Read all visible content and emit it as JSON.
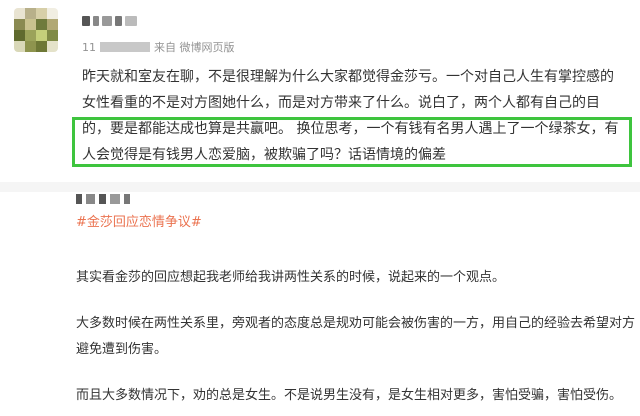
{
  "post": {
    "meta": {
      "date_prefix": "11",
      "source": "来自 微博网页版"
    },
    "lines": [
      "昨天就和室友在聊，不是很理解为什么大家都觉得金莎亏。一个对自己人生有掌控感的",
      "女性看重的不是对方图她什么，而是对方带来了什么。说白了，两个人都有自己的目",
      "的，要是都能达成也算是共赢吧。 换位思考，一个有钱有名男人遇上了一个绿茶女，有",
      "人会觉得是有钱男人恋爱脑，被欺骗了吗？话语情境的偏差"
    ],
    "highlight_color": "#3ec43e"
  },
  "article": {
    "hashtag": "#金莎回应恋情争议#",
    "hashtag_color": "#eb7350",
    "paragraphs": [
      "其实看金莎的回应想起我老师给我讲两性关系的时候，说起来的一个观点。",
      "大多数时候在两性关系里，旁观者的态度总是规劝可能会被伤害的一方，用自己的经验去希望对方",
      "避免遭到伤害。",
      "而且大多数情况下，劝的总是女生。不是说男生没有，是女生相对更多，害怕受骗，害怕受伤。"
    ]
  }
}
